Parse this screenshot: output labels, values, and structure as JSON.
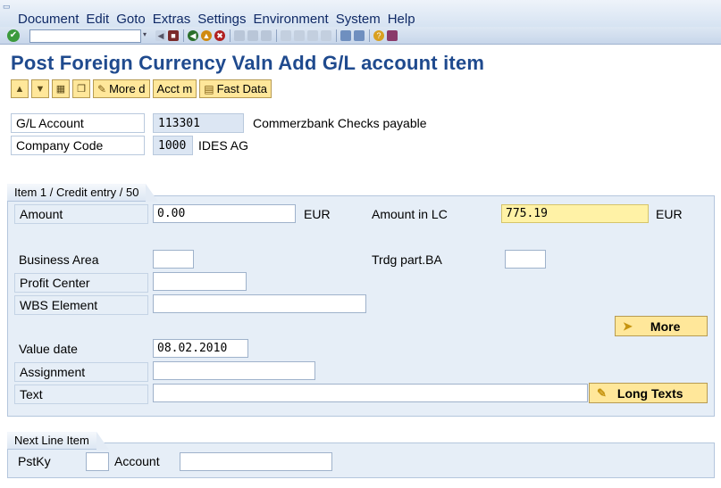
{
  "menu": {
    "items": [
      "Document",
      "Edit",
      "Goto",
      "Extras",
      "Settings",
      "Environment",
      "System",
      "Help"
    ]
  },
  "toolbar": {
    "command_field": "",
    "icons": [
      "enter-icon",
      "save-icon",
      "back-icon",
      "exit-icon",
      "cancel-icon",
      "print-icon",
      "find-icon",
      "find-next-icon",
      "first-page-icon",
      "prev-page-icon",
      "next-page-icon",
      "last-page-icon",
      "create-session-icon",
      "shortcut-icon",
      "help-icon",
      "layout-icon"
    ]
  },
  "page": {
    "title": "Post Foreign Currency Valn Add G/L account item"
  },
  "app_toolbar": {
    "buttons": [
      {
        "icon": "prev-item-icon",
        "label": ""
      },
      {
        "icon": "next-item-icon",
        "label": ""
      },
      {
        "icon": "overview-icon",
        "label": ""
      },
      {
        "icon": "copy-icon",
        "label": ""
      },
      {
        "icon": "more-data-icon",
        "label": "More d"
      },
      {
        "icon": "",
        "label": "Acct m"
      },
      {
        "icon": "fast-data-icon",
        "label": "Fast Data"
      }
    ]
  },
  "header": {
    "gl_account_label": "G/L Account",
    "gl_account_value": "113301",
    "gl_account_desc": "Commerzbank Checks payable",
    "company_code_label": "Company Code",
    "company_code_value": "1000",
    "company_code_desc": "IDES AG"
  },
  "item": {
    "tab_label": "Item 1 / Credit entry / 50",
    "amount_label": "Amount",
    "amount_value": "0.00",
    "amount_currency": "EUR",
    "amount_lc_label": "Amount in LC",
    "amount_lc_value": "775.19",
    "amount_lc_currency": "EUR",
    "business_area_label": "Business Area",
    "business_area_value": "",
    "trdg_part_label": "Trdg part.BA",
    "trdg_part_value": "",
    "profit_center_label": "Profit Center",
    "profit_center_value": "",
    "wbs_label": "WBS Element",
    "wbs_value": "",
    "more_button": "More",
    "value_date_label": "Value date",
    "value_date_value": "08.02.2010",
    "assignment_label": "Assignment",
    "assignment_value": "",
    "text_label": "Text",
    "text_value": "",
    "long_texts_button": "Long Texts"
  },
  "next_line": {
    "tab_label": "Next Line Item",
    "pstky_label": "PstKy",
    "pstky_value": "",
    "account_label": "Account",
    "account_value": ""
  },
  "colors": {
    "title": "#1f4a8e",
    "button_bg": "#ffe79a",
    "panel_bg": "#e6eef7",
    "highlight_field": "#fff2a6",
    "ok_icon": "#3c9a3c"
  }
}
